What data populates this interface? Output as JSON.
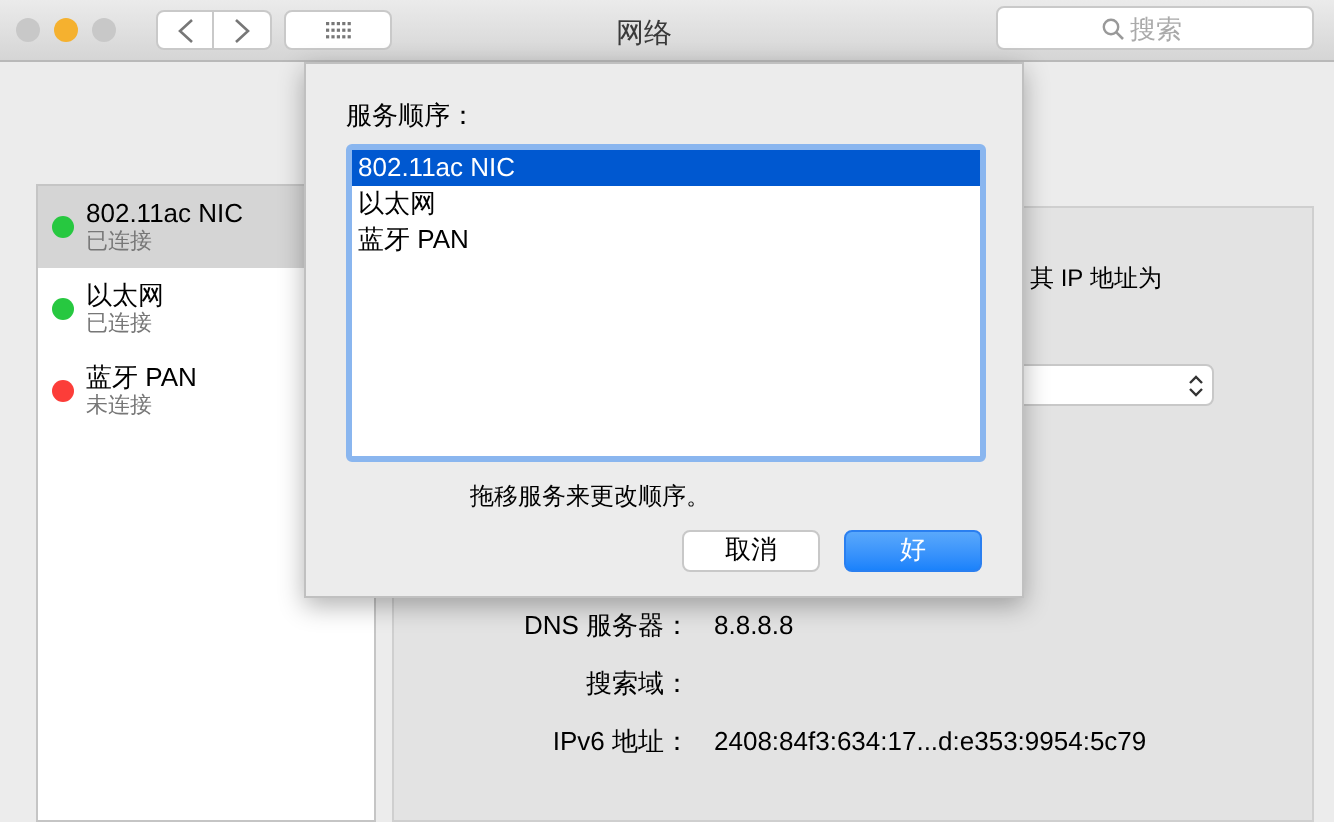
{
  "window": {
    "title": "网络",
    "traffic_lights": [
      {
        "color": "#c8c8c8"
      },
      {
        "color": "#f5b12f"
      },
      {
        "color": "#c8c8c8"
      }
    ]
  },
  "search": {
    "placeholder": "搜索"
  },
  "services": [
    {
      "name": "802.11ac NIC",
      "status": "已连接",
      "color": "#27c840",
      "selected": true
    },
    {
      "name": "以太网",
      "status": "已连接",
      "color": "#27c840",
      "selected": false
    },
    {
      "name": "蓝牙 PAN",
      "status": "未连接",
      "color": "#fc3d39",
      "selected": false
    }
  ],
  "detail": {
    "note": "其 IP 地址为",
    "rows": [
      {
        "label": "DNS 服务器：",
        "value": "8.8.8.8"
      },
      {
        "label": "搜索域：",
        "value": ""
      },
      {
        "label": "IPv6 地址：",
        "value": "2408:84f3:634:17...d:e353:9954:5c79"
      }
    ]
  },
  "sheet": {
    "title": "服务顺序：",
    "items": [
      {
        "name": "802.11ac NIC",
        "selected": true
      },
      {
        "name": "以太网",
        "selected": false
      },
      {
        "name": "蓝牙 PAN",
        "selected": false
      }
    ],
    "hint": "拖移服务来更改顺序。",
    "buttons": [
      {
        "label": "取消",
        "kind": "cancel"
      },
      {
        "label": "好",
        "kind": "default"
      }
    ]
  }
}
